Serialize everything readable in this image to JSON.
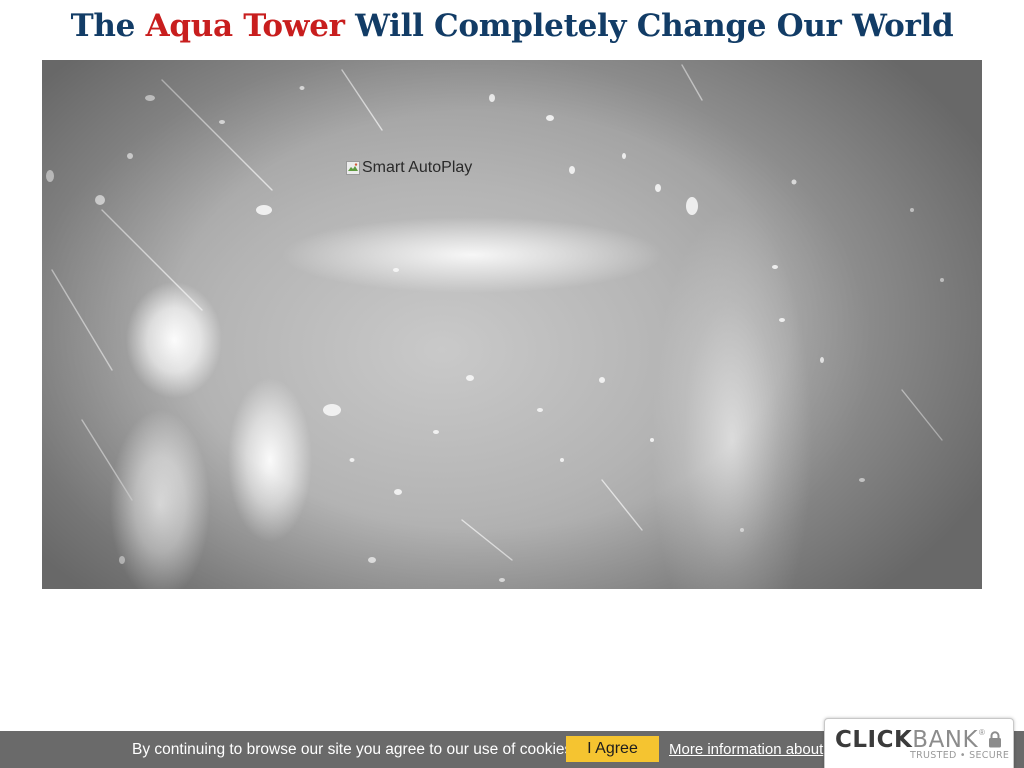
{
  "headline": {
    "prefix": "The ",
    "highlight": "Aqua Tower",
    "suffix": " Will Completely Change Our World",
    "color": "#123c66",
    "highlight_color": "#c81e1e"
  },
  "video": {
    "image_alt": "Smart AutoPlay",
    "icon": "broken-image-icon"
  },
  "cookie_bar": {
    "message": "By continuing to browse our site you agree to our use of cookies.",
    "agree_label": "I Agree",
    "more_info_label": "More information about",
    "background": "#6a6a6a",
    "button_color": "#f5c430"
  },
  "clickbank_badge": {
    "brand_click": "CLICK",
    "brand_bank": "BANK",
    "registered": "®",
    "tagline": "TRUSTED • SECURE",
    "icon": "lock-icon"
  }
}
